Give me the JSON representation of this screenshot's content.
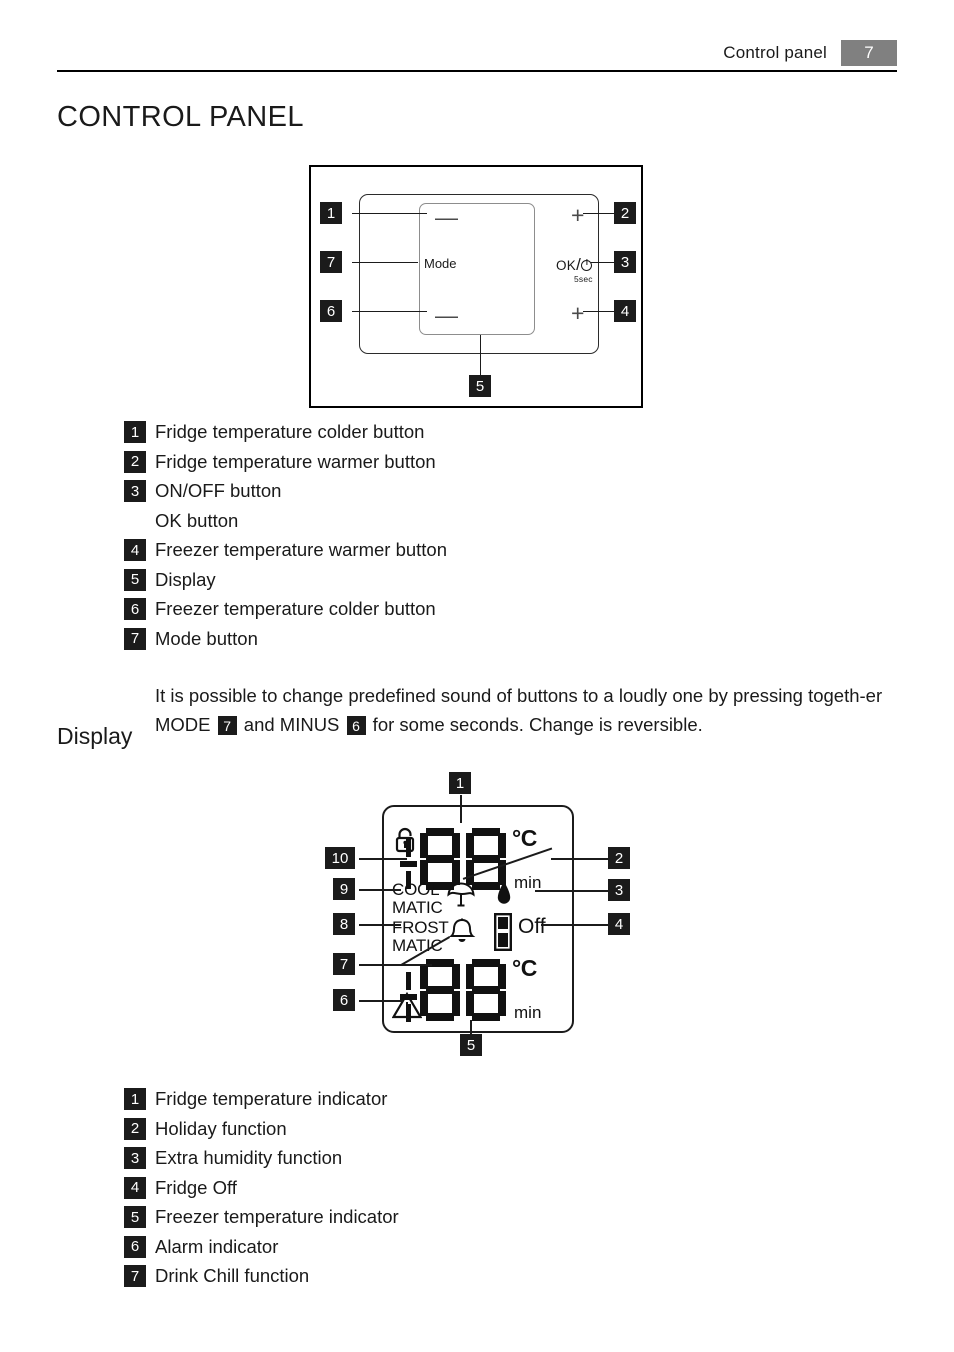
{
  "header": {
    "title": "Control panel",
    "page_number": "7"
  },
  "headings": {
    "main_title": "CONTROL PANEL",
    "display_section": "Display"
  },
  "control_panel_figure": {
    "buttons": {
      "minus_top": "—",
      "mode": "Mode",
      "minus_bottom": "—",
      "plus_top": "+",
      "plus_bottom": "+",
      "ok_label": "OK",
      "ok_slash": "/",
      "ok_seconds": "5sec",
      "power_icon": "power-icon"
    },
    "callouts": {
      "c1": "1",
      "c2": "2",
      "c3": "3",
      "c4": "4",
      "c5": "5",
      "c6": "6",
      "c7": "7"
    }
  },
  "panel_legend": [
    {
      "num": "1",
      "text": "Fridge temperature colder button"
    },
    {
      "num": "2",
      "text": "Fridge temperature warmer button"
    },
    {
      "num": "3",
      "text": "ON/OFF button"
    },
    {
      "num": "",
      "text": "OK button"
    },
    {
      "num": "4",
      "text": "Freezer temperature warmer button"
    },
    {
      "num": "5",
      "text": "Display"
    },
    {
      "num": "6",
      "text": "Freezer temperature colder button"
    },
    {
      "num": "7",
      "text": "Mode button"
    }
  ],
  "note": {
    "part1": "It is possible to change predefined sound of buttons to a loudly one by pressing together-er MODE ",
    "line1": "It is possible to change predefined sound of buttons to a loudly one by pressing togeth-",
    "line2_a": "er MODE ",
    "badge_mode": "7",
    "line2_b": " and MINUS ",
    "badge_minus": "6",
    "line2_c": " for some seconds. Change is reversible."
  },
  "display_figure": {
    "fridge_digits": "88",
    "freezer_digits": "88",
    "unit_celsius_top": "°C",
    "unit_celsius_bottom": "°C",
    "unit_min_top": "min",
    "unit_min_bottom": "min",
    "coolmatic": "COOL\nMATIC",
    "frostmatic": "FROST\nMATIC",
    "off_label": "Off",
    "icons": {
      "lock": "padlock-icon",
      "umbrella": "umbrella-holiday-icon",
      "droplet": "humidity-droplet-icon",
      "bell": "alarm-bell-icon",
      "fridge": "fridge-off-icon",
      "warning": "warning-triangle-icon"
    },
    "callouts": {
      "c1": "1",
      "c2": "2",
      "c3": "3",
      "c4": "4",
      "c5": "5",
      "c6": "6",
      "c7": "7",
      "c8": "8",
      "c9": "9",
      "c10": "10"
    }
  },
  "display_legend": [
    {
      "num": "1",
      "text": "Fridge temperature indicator"
    },
    {
      "num": "2",
      "text": "Holiday function"
    },
    {
      "num": "3",
      "text": "Extra humidity function"
    },
    {
      "num": "4",
      "text": "Fridge Off"
    },
    {
      "num": "5",
      "text": "Freezer temperature indicator"
    },
    {
      "num": "6",
      "text": "Alarm indicator"
    },
    {
      "num": "7",
      "text": "Drink Chill function"
    }
  ],
  "colors": {
    "badge_bg": "#1b1b1b",
    "header_page_bg": "#808080",
    "text": "#1a1a1a"
  }
}
